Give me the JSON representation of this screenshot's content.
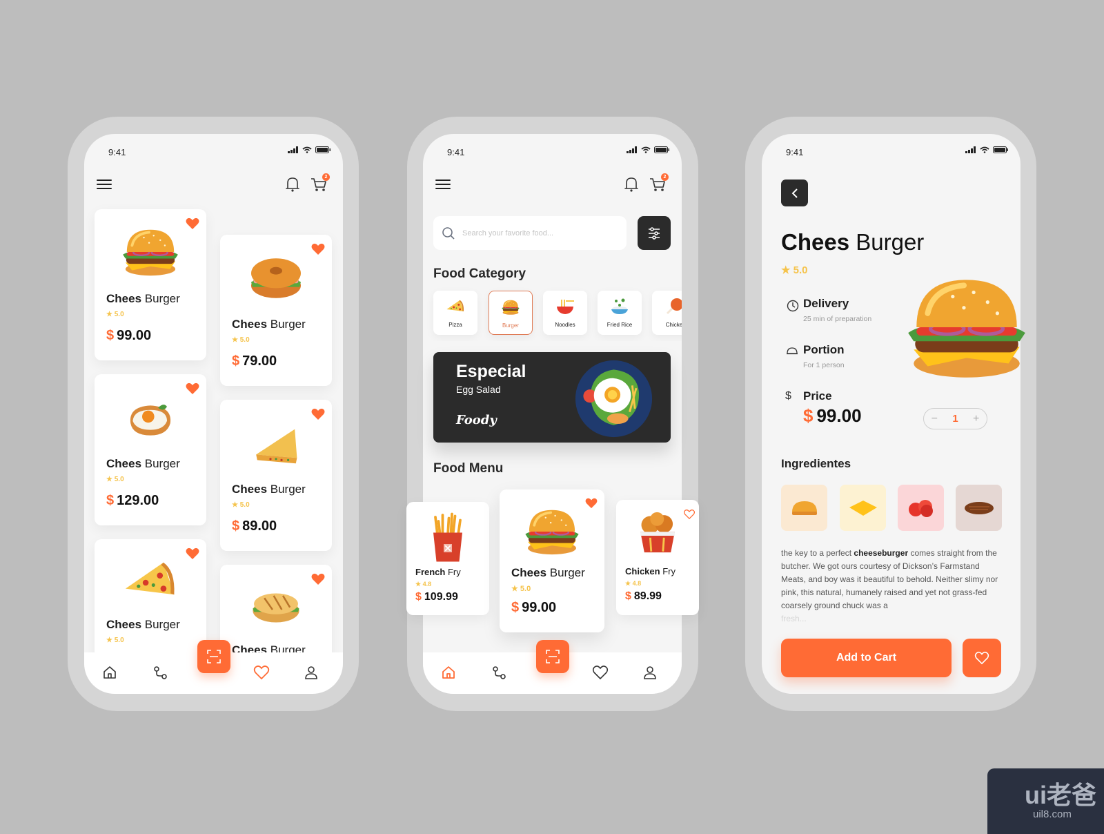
{
  "colors": {
    "accent": "#ff6b35",
    "dark": "#2b2b2b",
    "rating": "#f5c34b",
    "background": "#bdbdbd"
  },
  "status": {
    "time": "9:41"
  },
  "cart_badge": "2",
  "phone1": {
    "cards": [
      {
        "bold": "Chees",
        "light": "Burger",
        "rating": "5.0",
        "currency": "$",
        "price": "99.00",
        "image": "burger",
        "favorite": true
      },
      {
        "bold": "Chees",
        "light": "Burger",
        "rating": "5.0",
        "currency": "$",
        "price": "79.00",
        "image": "bagel",
        "favorite": true
      },
      {
        "bold": "Chees",
        "light": "Burger",
        "rating": "5.0",
        "currency": "$",
        "price": "129.00",
        "image": "egg-toast",
        "favorite": true
      },
      {
        "bold": "Chees",
        "light": "Burger",
        "rating": "5.0",
        "currency": "$",
        "price": "89.00",
        "image": "quesadilla",
        "favorite": true
      },
      {
        "bold": "Chees",
        "light": "Burger",
        "rating": "5.0",
        "image": "pizza",
        "favorite": true
      },
      {
        "bold": "Chees",
        "light": "Burger",
        "image": "sandwich",
        "favorite": true
      }
    ],
    "nav_active": "favorites"
  },
  "phone2": {
    "search_placeholder": "Search your favorite food...",
    "category_title": "Food Category",
    "categories": [
      {
        "label": "Pizza",
        "icon": "pizza-icon"
      },
      {
        "label": "Burger",
        "icon": "burger-icon",
        "selected": true
      },
      {
        "label": "Noodles",
        "icon": "noodles-icon"
      },
      {
        "label": "Fried Rice",
        "icon": "fried-rice-icon"
      },
      {
        "label": "Chicke",
        "icon": "chicken-icon"
      }
    ],
    "banner": {
      "title": "Especial",
      "subtitle": "Egg Salad",
      "brand": "Foody"
    },
    "menu_title": "Food Menu",
    "menu": [
      {
        "bold": "French",
        "light": "Fry",
        "rating": "4.8",
        "currency": "$",
        "price": "109.99",
        "image": "fries",
        "favorite": false
      },
      {
        "bold": "Chees",
        "light": "Burger",
        "rating": "5.0",
        "currency": "$",
        "price": "99.00",
        "image": "burger",
        "favorite": true
      },
      {
        "bold": "Chicken",
        "light": "Fry",
        "rating": "4.8",
        "currency": "$",
        "price": "89.99",
        "image": "chicken",
        "favorite": false
      }
    ],
    "nav_active": "home"
  },
  "phone3": {
    "title_bold": "Chees",
    "title_light": "Burger",
    "rating": "5.0",
    "delivery": {
      "label": "Delivery",
      "sub": "25 min of preparation"
    },
    "portion": {
      "label": "Portion",
      "sub": "For 1 person"
    },
    "price": {
      "label": "Price",
      "currency": "$",
      "value": "99.00"
    },
    "quantity": "1",
    "ingredients_title": "Ingredientes",
    "ingredients": [
      "bun",
      "cheese",
      "tomato",
      "patty"
    ],
    "description_pre": "the key to a perfect ",
    "description_bold": "cheeseburger",
    "description_post": " comes straight from the butcher. We got ours courtesy of Dickson’s Farmstand Meats, and boy was it beautiful to behold. Neither slimy nor pink, this natural, humanely raised and yet not grass-fed coarsely ground chuck was a",
    "description_fade": "fresh...",
    "add_to_cart": "Add to Cart"
  },
  "watermark": {
    "logo": "ui老爸",
    "url": "uil8.com"
  }
}
